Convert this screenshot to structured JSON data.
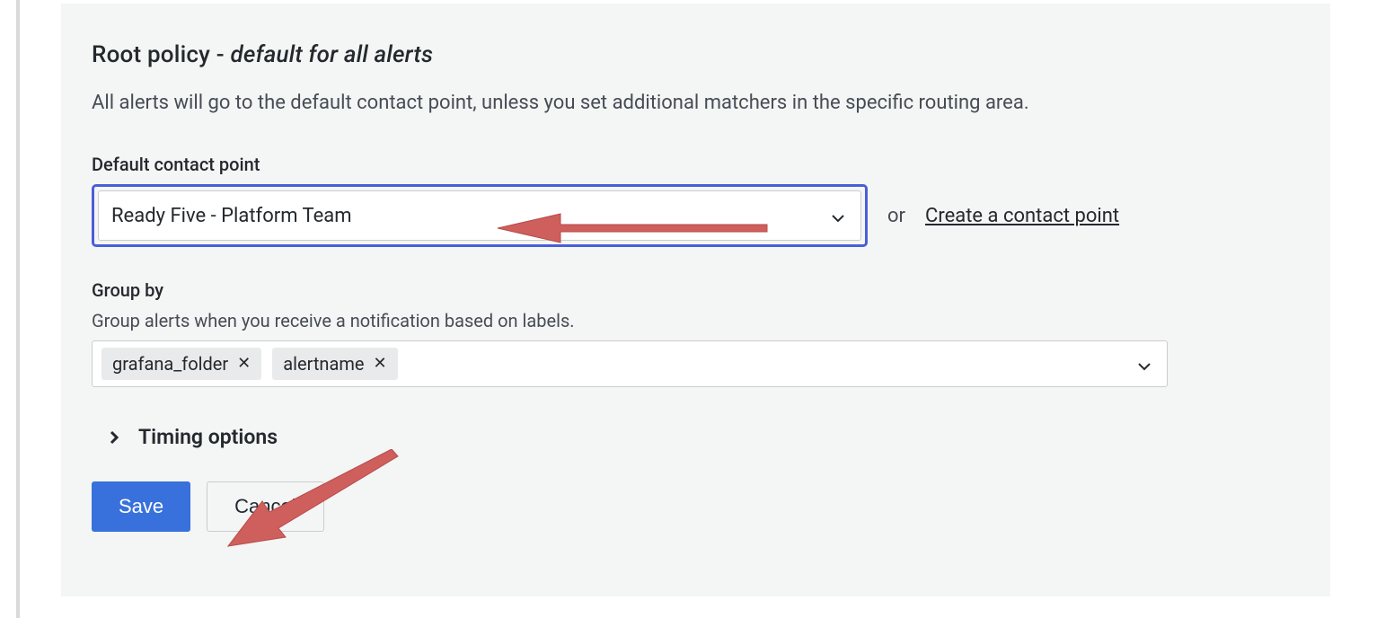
{
  "header": {
    "title_prefix": "Root policy - ",
    "title_italic": "default for all alerts",
    "description": "All alerts will go to the default contact point, unless you set additional matchers in the specific routing area."
  },
  "contact_point": {
    "label": "Default contact point",
    "selected": "Ready Five - Platform Team",
    "or_text": "or",
    "create_link": "Create a contact point"
  },
  "group_by": {
    "label": "Group by",
    "helper": "Group alerts when you receive a notification based on labels.",
    "chips": [
      {
        "label": "grafana_folder"
      },
      {
        "label": "alertname"
      }
    ]
  },
  "timing": {
    "label": "Timing options"
  },
  "buttons": {
    "save": "Save",
    "cancel": "Cancel"
  }
}
